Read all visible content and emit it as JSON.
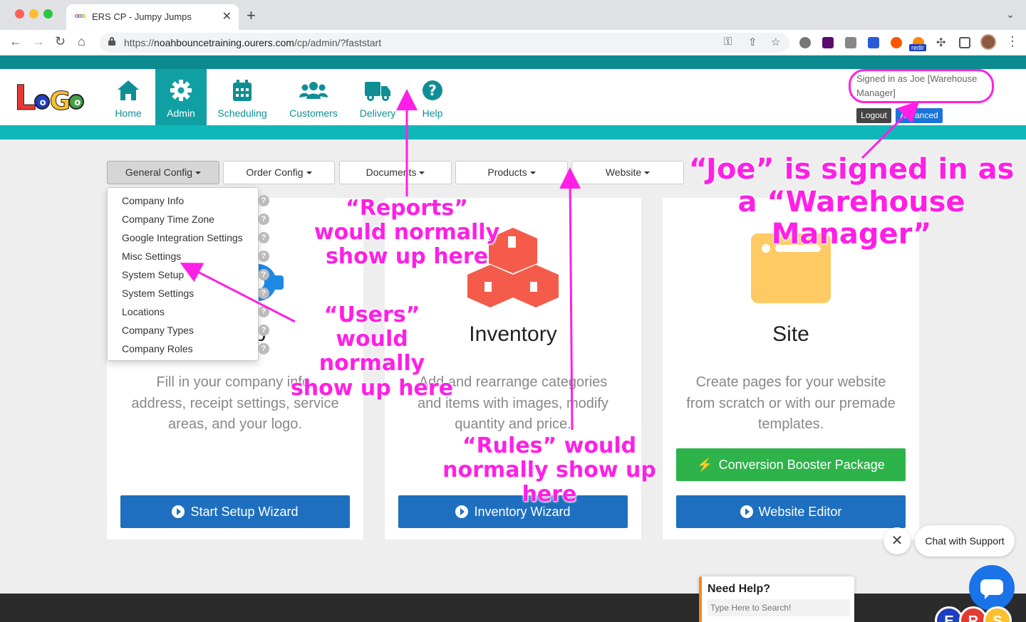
{
  "browser": {
    "tab_title": "ERS CP - Jumpy Jumps",
    "url_prefix": "https://",
    "url_host": "noahbouncetraining.ourers.com",
    "url_path": "/cp/admin/?faststart",
    "ext_redir": "redir"
  },
  "logo": {
    "l1": "L",
    "l2": "o",
    "l3": "G",
    "l4": "o"
  },
  "nav": {
    "items": [
      {
        "label": "Home",
        "icon": "home-icon"
      },
      {
        "label": "Admin",
        "icon": "gear-icon"
      },
      {
        "label": "Scheduling",
        "icon": "calendar-icon"
      },
      {
        "label": "Customers",
        "icon": "users-icon"
      },
      {
        "label": "Delivery",
        "icon": "truck-icon"
      },
      {
        "label": "Help",
        "icon": "question-icon"
      }
    ]
  },
  "user": {
    "signed_in": "Signed in as Joe [Warehouse Manager]",
    "logout": "Logout",
    "advanced": "Advanced"
  },
  "config_menu": [
    "General Config",
    "Order Config",
    "Documents",
    "Products",
    "Website"
  ],
  "dropdown": [
    "Company Info",
    "Company Time Zone",
    "Google Integration Settings",
    "Misc Settings",
    "System Setup",
    "System Settings",
    "Locations",
    "Company Types",
    "Company Roles"
  ],
  "cards": {
    "setup": {
      "title_suffix": "p",
      "desc": "Fill in your company info, address, receipt settings, service areas, and your logo.",
      "button": "Start Setup Wizard"
    },
    "inventory": {
      "title": "Inventory",
      "desc": "Add and rearrange categories and items with images, modify quantity and price.",
      "button": "Inventory Wizard"
    },
    "site": {
      "title": "Site",
      "desc": "Create pages for your website from scratch or with our premade templates.",
      "button_green": "Conversion Booster Package",
      "button": "Website Editor"
    }
  },
  "widgets": {
    "help_title": "Need Help?",
    "help_placeholder": "Type Here to Search!",
    "chat_label": "Chat with Support"
  },
  "ers_badges": [
    "E",
    "R",
    "S"
  ],
  "annotations": {
    "joe": "“Joe” is signed in as a “Warehouse Manager”",
    "reports": "“Reports” would normally show up here",
    "users": "“Users” would normally show up here",
    "rules": "“Rules” would normally show up here"
  },
  "colors": {
    "teal_dark": "#0b8a8f",
    "teal_light": "#10b7b9",
    "primary": "#1e6fbf",
    "green": "#2db34a",
    "annotation": "#ff1fe6"
  }
}
